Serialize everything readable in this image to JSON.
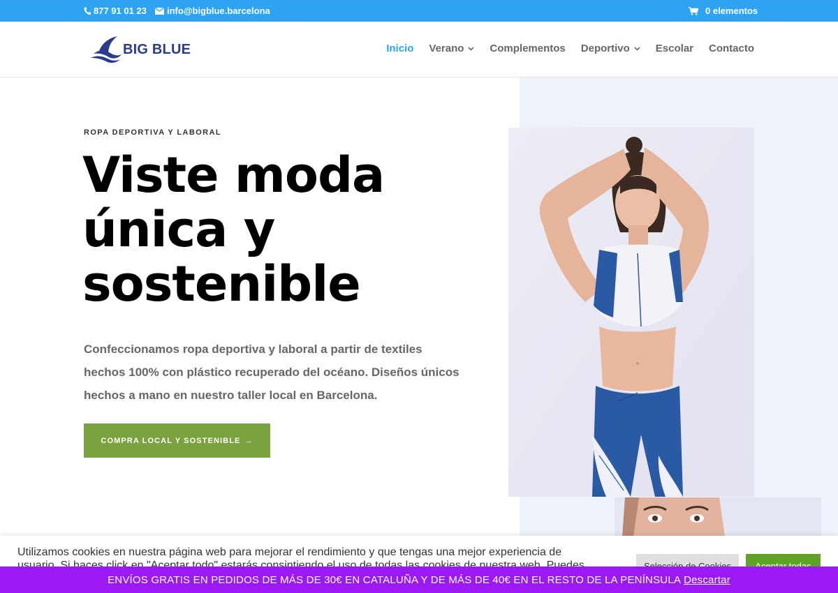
{
  "topbar": {
    "phone": "877 91 01 23",
    "email": "info@bigblue.barcelona",
    "cart": "0 elementos",
    "bg_color": "#2ea3f2"
  },
  "header": {
    "logo_text": "BIG BLUE",
    "nav": [
      {
        "label": "Inicio",
        "active": true
      },
      {
        "label": "Verano",
        "dropdown": true
      },
      {
        "label": "Complementos"
      },
      {
        "label": "Deportivo",
        "dropdown": true
      },
      {
        "label": "Escolar"
      },
      {
        "label": "Contacto"
      }
    ],
    "accent_color": "#2ea3f2"
  },
  "hero": {
    "eyebrow": "ROPA DEPORTIVA Y LABORAL",
    "headline": [
      "Viste moda",
      "única y",
      "sostenible"
    ],
    "description": [
      "Confeccionamos ropa deportiva y laboral a partir de textiles",
      "hechos 100% con plástico recuperado del océano. Diseños únicos",
      "hechos a mano en nuestro taller local en Barcelona."
    ],
    "cta_label": "COMPRA LOCAL Y SOSTENIBLE",
    "cta_arrow": "→",
    "cta_color": "#7aa23f"
  },
  "cookie": {
    "text": "Utilizamos cookies en nuestra página web para mejorar el rendimiento y que tengas una mejor experiencia de usuario. Si haces click en \"Aceptar todo\" estarás consintiendo el uso de todas las cookies de nuestra web. Puedes",
    "settings_label": "Selección de Cookies",
    "accept_label": "Aceptar todas"
  },
  "shipping": {
    "text": "ENVÍOS GRATIS EN PEDIDOS DE MÁS DE 30€ EN CATALUÑA Y DE MÁS DE 40€ EN EL RESTO DE LA PENÍNSULA",
    "dismiss_label": "Descartar",
    "bg_color": "#9b19f5"
  }
}
